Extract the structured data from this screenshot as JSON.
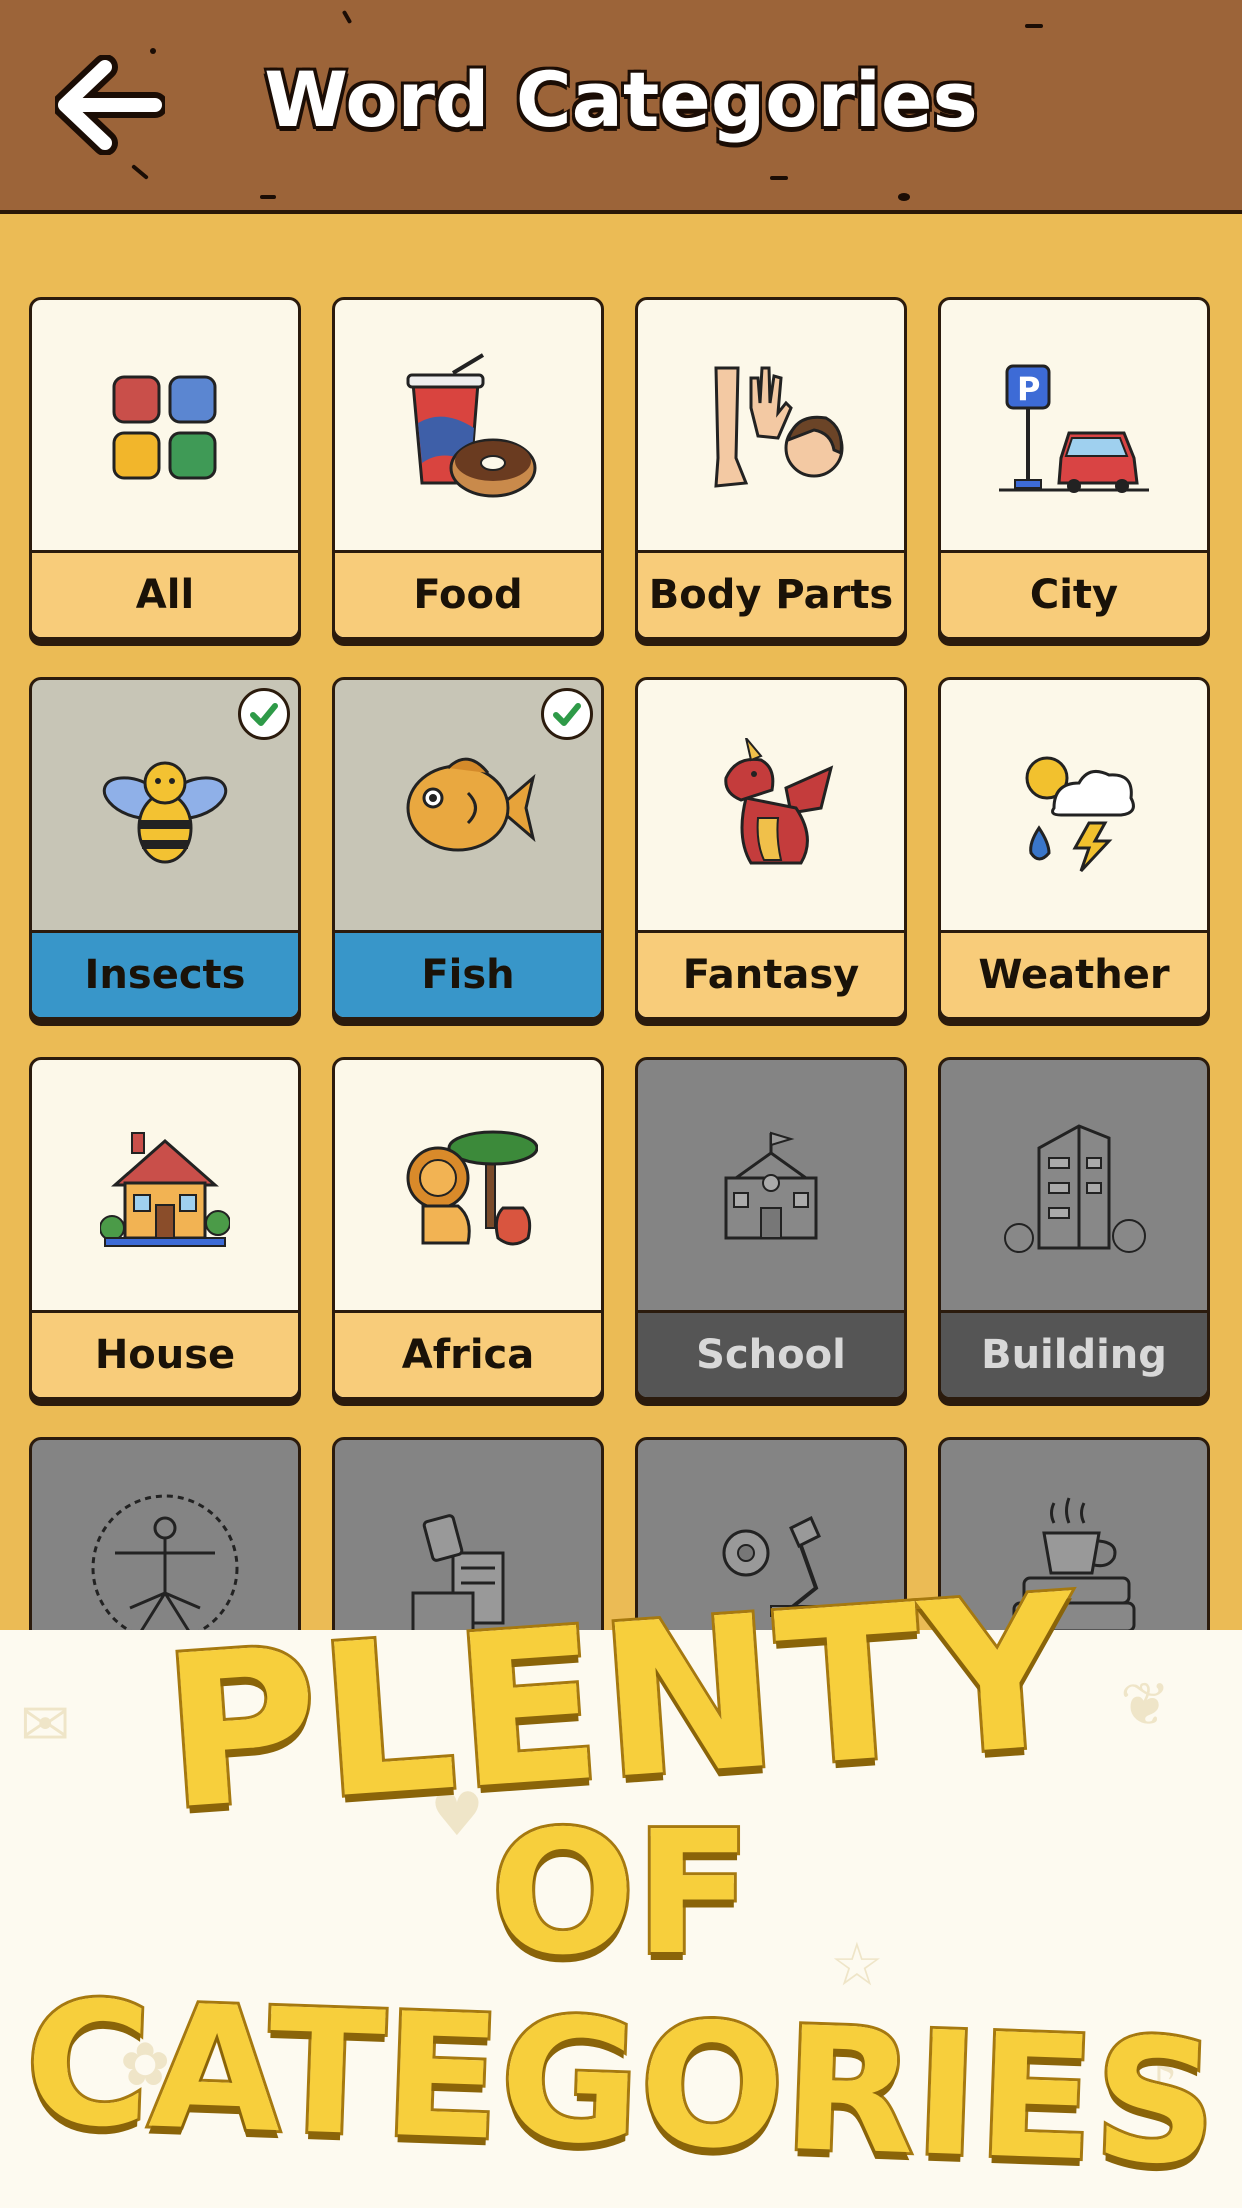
{
  "header": {
    "title": "Word Categories",
    "back_icon": "arrow-left-icon"
  },
  "colors": {
    "header_bg": "#9c6439",
    "grid_bg": "#ebbb55",
    "card_label_bg": "#f8cc7a",
    "selected_label_bg": "#3896c9",
    "locked_card_bg": "#848484",
    "promo_text": "#f7cf3c"
  },
  "categories": [
    {
      "label": "All",
      "icon": "grid-squares-icon",
      "state": "normal"
    },
    {
      "label": "Food",
      "icon": "soda-donut-icon",
      "state": "normal"
    },
    {
      "label": "Body Parts",
      "icon": "body-parts-icon",
      "state": "normal"
    },
    {
      "label": "City",
      "icon": "parking-car-icon",
      "state": "normal"
    },
    {
      "label": "Insects",
      "icon": "bee-icon",
      "state": "selected"
    },
    {
      "label": "Fish",
      "icon": "fish-icon",
      "state": "selected"
    },
    {
      "label": "Fantasy",
      "icon": "dragon-icon",
      "state": "normal"
    },
    {
      "label": "Weather",
      "icon": "weather-icon",
      "state": "normal"
    },
    {
      "label": "House",
      "icon": "house-icon",
      "state": "normal"
    },
    {
      "label": "Africa",
      "icon": "lion-tree-icon",
      "state": "normal"
    },
    {
      "label": "School",
      "icon": "school-icon",
      "state": "locked"
    },
    {
      "label": "Building",
      "icon": "building-icon",
      "state": "locked"
    },
    {
      "label": "",
      "icon": "vitruvian-man-icon",
      "state": "locked"
    },
    {
      "label": "",
      "icon": "office-desk-icon",
      "state": "locked"
    },
    {
      "label": "",
      "icon": "science-icon",
      "state": "locked"
    },
    {
      "label": "",
      "icon": "coffee-books-icon",
      "state": "locked"
    }
  ],
  "promo": {
    "line1": "PLENTY",
    "line2": "OF",
    "line3": "CATEGORIES"
  }
}
